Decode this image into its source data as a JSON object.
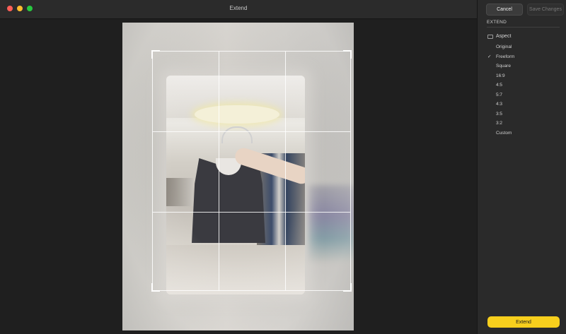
{
  "window": {
    "title": "Extend"
  },
  "toolbar": {
    "cancel_label": "Cancel",
    "save_label": "Save Changes"
  },
  "panel": {
    "section_label": "EXTEND",
    "aspect_label": "Aspect",
    "ratios": [
      {
        "label": "Original",
        "selected": false
      },
      {
        "label": "Freeform",
        "selected": true
      },
      {
        "label": "Square",
        "selected": false
      },
      {
        "label": "16:9",
        "selected": false
      },
      {
        "label": "4:5",
        "selected": false
      },
      {
        "label": "5:7",
        "selected": false
      },
      {
        "label": "4:3",
        "selected": false
      },
      {
        "label": "3:5",
        "selected": false
      },
      {
        "label": "3:2",
        "selected": false
      },
      {
        "label": "Custom",
        "selected": false
      }
    ],
    "check_glyph": "✓",
    "extend_label": "Extend"
  },
  "colors": {
    "accent": "#f7cf1d",
    "traffic_red": "#ff5f57",
    "traffic_yellow": "#febc2e",
    "traffic_green": "#28c840"
  },
  "icons": {
    "aspect": "aspect-ratio-icon",
    "check": "checkmark-icon"
  }
}
